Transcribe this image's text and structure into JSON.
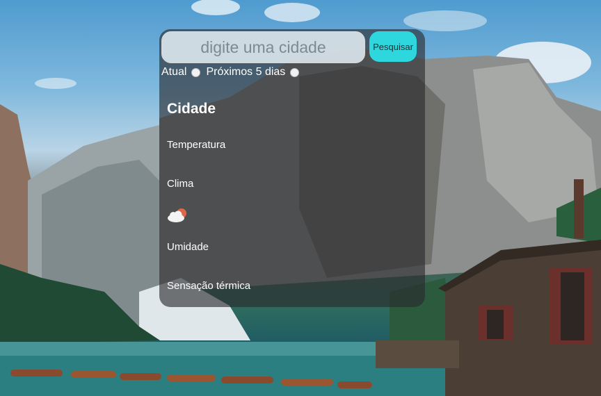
{
  "search": {
    "placeholder": "digite uma cidade",
    "button_label": "Pesquisar"
  },
  "tabs": [
    {
      "label": "Atual"
    },
    {
      "label": "Próximos 5 dias"
    }
  ],
  "weather": {
    "city": "Cidade",
    "temperature_label": "Temperatura",
    "climate_label": "Clima",
    "icon": "partly-cloudy-icon",
    "humidity_label": "Umidade",
    "feels_like_label": "Sensação térmica"
  },
  "colors": {
    "button": "#2ed7dd",
    "panel": "rgba(40,40,44,0.62)"
  }
}
